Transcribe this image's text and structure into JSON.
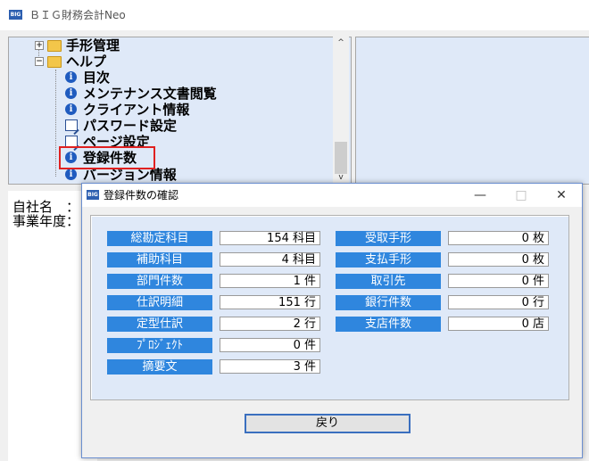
{
  "app": {
    "icon": "BIG",
    "title": "ＢＩＧ財務会計Neo"
  },
  "tree": {
    "items": [
      {
        "label": "手形管理",
        "icon": "folder-icon"
      },
      {
        "label": "ヘルプ",
        "icon": "folder-icon"
      },
      {
        "label": "目次",
        "icon": "info-icon"
      },
      {
        "label": "メンテナンス文書閲覧",
        "icon": "info-icon"
      },
      {
        "label": "クライアント情報",
        "icon": "info-icon"
      },
      {
        "label": "パスワード設定",
        "icon": "edit-icon"
      },
      {
        "label": "ページ設定",
        "icon": "edit-icon"
      },
      {
        "label": "登録件数",
        "icon": "info-icon"
      },
      {
        "label": "バージョン情報",
        "icon": "info-icon"
      }
    ],
    "expand_plus": "+",
    "expand_minus": "−",
    "scroll_up": "^",
    "scroll_down": "v"
  },
  "info": {
    "company_label": "自社名　：",
    "year_label": "事業年度："
  },
  "dialog": {
    "icon": "BIG",
    "title": "登録件数の確認",
    "minimize": "—",
    "maximize": "□",
    "close": "✕",
    "left_fields": [
      {
        "label": "総勘定科目",
        "value": "154 科目"
      },
      {
        "label": "補助科目",
        "value": "4 科目"
      },
      {
        "label": "部門件数",
        "value": "1 件"
      },
      {
        "label": "仕訳明細",
        "value": "151 行"
      },
      {
        "label": "定型仕訳",
        "value": "2 行"
      },
      {
        "label": "ﾌﾟﾛｼﾞｪｸﾄ",
        "value": "0 件"
      },
      {
        "label": "摘要文",
        "value": "3 件"
      }
    ],
    "right_fields": [
      {
        "label": "受取手形",
        "value": "0 枚"
      },
      {
        "label": "支払手形",
        "value": "0 枚"
      },
      {
        "label": "取引先",
        "value": "0 件"
      },
      {
        "label": "銀行件数",
        "value": "0 行"
      },
      {
        "label": "支店件数",
        "value": "0 店"
      }
    ],
    "back_label": "戻り"
  },
  "colors": {
    "accent": "#2f86de",
    "panel": "#dfe9f8",
    "highlight": "#e02020"
  }
}
